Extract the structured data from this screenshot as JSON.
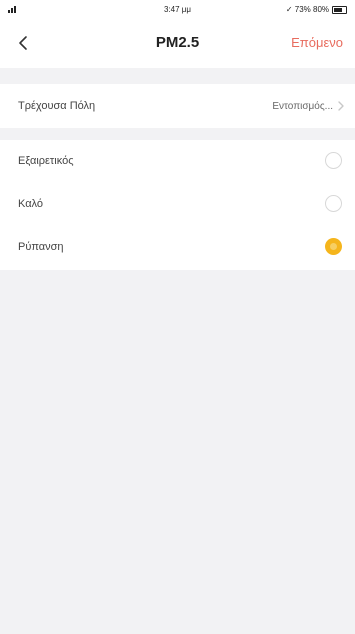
{
  "status_bar": {
    "time": "3:47 μμ",
    "right_text": "✓ 73% 80%"
  },
  "nav": {
    "title": "PM2.5",
    "next_label": "Επόμενο",
    "back_icon": "chevron-left-icon"
  },
  "city": {
    "label": "Τρέχουσα Πόλη",
    "value": "Εντοπισμός...",
    "chevron_icon": "chevron-right-icon"
  },
  "options": [
    {
      "label": "Εξαιρετικός",
      "selected": false
    },
    {
      "label": "Καλό",
      "selected": false
    },
    {
      "label": "Ρύπανση",
      "selected": true
    }
  ],
  "colors": {
    "accent": "#e86c5e",
    "selected_radio": "#f5b51c",
    "background": "#f2f2f4"
  }
}
